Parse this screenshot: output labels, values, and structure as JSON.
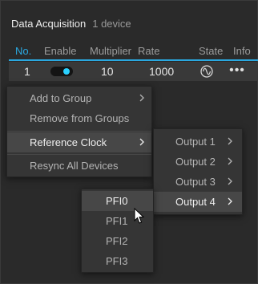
{
  "panel": {
    "title": "Data Acquisition",
    "subtitle": "1 device"
  },
  "table": {
    "columns": [
      "No.",
      "Enable",
      "Multiplier",
      "Rate",
      "State",
      "Info"
    ],
    "row": {
      "no": "1",
      "enabled": true,
      "multiplier": "10",
      "rate": "1000",
      "state_icon": "waveform-icon",
      "info_icon": "more-icon"
    }
  },
  "context_menu": {
    "items": [
      {
        "label": "Add to Group",
        "has_submenu": true
      },
      {
        "label": "Remove from Groups"
      },
      {
        "label": "Reference Clock",
        "has_submenu": true,
        "highlighted": true
      },
      {
        "label": "Resync All Devices"
      }
    ]
  },
  "reference_clock_menu": {
    "items": [
      {
        "label": "Output 1",
        "has_submenu": true
      },
      {
        "label": "Output 2",
        "has_submenu": true
      },
      {
        "label": "Output 3",
        "has_submenu": true
      },
      {
        "label": "Output 4",
        "has_submenu": true,
        "highlighted": true
      }
    ]
  },
  "output4_menu": {
    "items": [
      {
        "label": "PFI0",
        "highlighted": true
      },
      {
        "label": "PFI1"
      },
      {
        "label": "PFI2"
      },
      {
        "label": "PFI3"
      }
    ]
  },
  "colors": {
    "accent": "#2aa8e0",
    "toggle_knob": "#2ad1ff",
    "highlight": "#474747",
    "menu_bg": "#353535"
  }
}
